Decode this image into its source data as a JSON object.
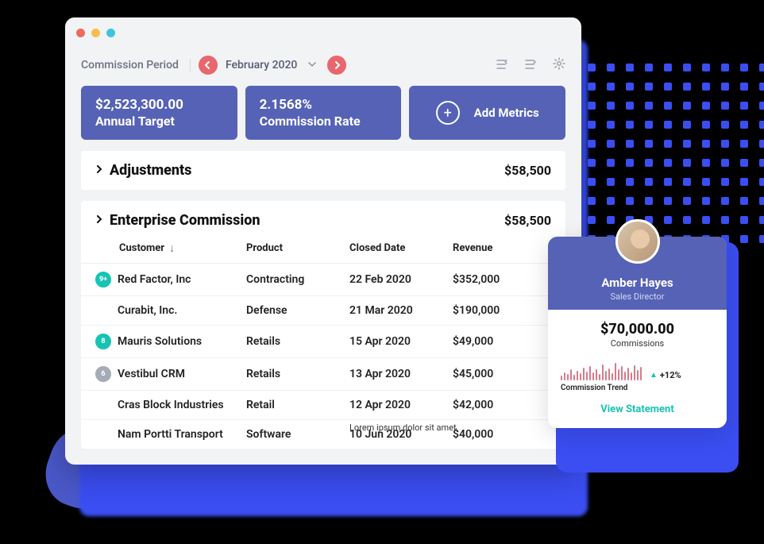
{
  "header": {
    "period_label": "Commission Period",
    "period_value": "February 2020"
  },
  "metrics": [
    {
      "value": "$2,523,300.00",
      "label": "Annual Target"
    },
    {
      "value": "2.1568%",
      "label": "Commission Rate"
    }
  ],
  "add_metrics_label": "Add Metrics",
  "adjustments": {
    "title": "Adjustments",
    "amount": "$58,500"
  },
  "enterprise": {
    "title": "Enterprise Commission",
    "amount": "$58,500",
    "columns": {
      "customer": "Customer",
      "product": "Product",
      "closed": "Closed Date",
      "revenue": "Revenue"
    },
    "rows": [
      {
        "badge": "9+",
        "badge_color": "teal",
        "customer": "Red Factor, Inc",
        "product": "Contracting",
        "closed": "22 Feb 2020",
        "revenue": "$352,000"
      },
      {
        "badge": "",
        "badge_color": "",
        "customer": "Curabit, Inc.",
        "product": "Defense",
        "closed": "21 Mar 2020",
        "revenue": "$190,000"
      },
      {
        "badge": "8",
        "badge_color": "teal",
        "customer": "Mauris Solutions",
        "product": "Retails",
        "closed": "15 Apr 2020",
        "revenue": "$49,000"
      },
      {
        "badge": "6",
        "badge_color": "gray",
        "customer": "Vestibul CRM",
        "product": "Retails",
        "closed": "13 Apr 2020",
        "revenue": "$45,000"
      },
      {
        "badge": "",
        "badge_color": "",
        "customer": "Cras Block Industries",
        "product": "Retail",
        "closed": "12 Apr 2020",
        "revenue": "$42,000"
      },
      {
        "badge": "",
        "badge_color": "",
        "customer": "Nam Portti Transport",
        "product": "Software",
        "closed": "10 Jun 2020",
        "revenue": "$40,000"
      }
    ]
  },
  "lorem": "Lorem ipsum dolor sit amet,",
  "profile": {
    "name": "Amber Hayes",
    "role": "Sales Director",
    "commission_amount": "$70,000.00",
    "commission_label": "Commissions",
    "trend_pct": "+12%",
    "trend_label": "Commission Trend",
    "view_statement": "View Statement"
  }
}
